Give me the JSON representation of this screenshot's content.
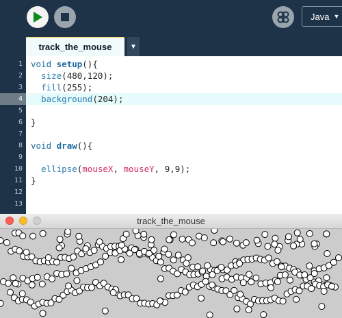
{
  "toolbar": {
    "run_icon": "play-icon",
    "stop_icon": "stop-icon",
    "debug_icon": "butterfly-icon",
    "mode_label": "Java",
    "mode_caret": "▼"
  },
  "tab": {
    "title": "track_the_mouse",
    "menu_icon": "▼"
  },
  "editor": {
    "current_line": 4,
    "line_numbers": [
      "1",
      "2",
      "3",
      "4",
      "5",
      "6",
      "7",
      "8",
      "9",
      "10",
      "11",
      "12",
      "13"
    ],
    "code": [
      [
        {
          "t": "void ",
          "c": "kw"
        },
        {
          "t": "setup",
          "c": "fn"
        },
        {
          "t": "(){",
          "c": ""
        }
      ],
      [
        {
          "t": "  ",
          "c": ""
        },
        {
          "t": "size",
          "c": "bi"
        },
        {
          "t": "(480,120);",
          "c": ""
        }
      ],
      [
        {
          "t": "  ",
          "c": ""
        },
        {
          "t": "fill",
          "c": "bi"
        },
        {
          "t": "(255);",
          "c": ""
        }
      ],
      [
        {
          "t": "  ",
          "c": ""
        },
        {
          "t": "background",
          "c": "bi"
        },
        {
          "t": "(204);",
          "c": ""
        }
      ],
      [],
      [
        {
          "t": "}",
          "c": ""
        }
      ],
      [],
      [
        {
          "t": "void ",
          "c": "kw"
        },
        {
          "t": "draw",
          "c": "fn"
        },
        {
          "t": "(){",
          "c": ""
        }
      ],
      [],
      [
        {
          "t": "  ",
          "c": ""
        },
        {
          "t": "ellipse",
          "c": "bi"
        },
        {
          "t": "(",
          "c": ""
        },
        {
          "t": "mouseX",
          "c": "var"
        },
        {
          "t": ", ",
          "c": ""
        },
        {
          "t": "mouseY",
          "c": "var"
        },
        {
          "t": ", 9,9);",
          "c": ""
        }
      ],
      [
        {
          "t": "}",
          "c": ""
        }
      ],
      [],
      []
    ]
  },
  "sketch_window": {
    "title": "track_the_mouse",
    "colors": {
      "background": "#cccccc",
      "fill": "#ffffff",
      "stroke": "#000000"
    }
  }
}
